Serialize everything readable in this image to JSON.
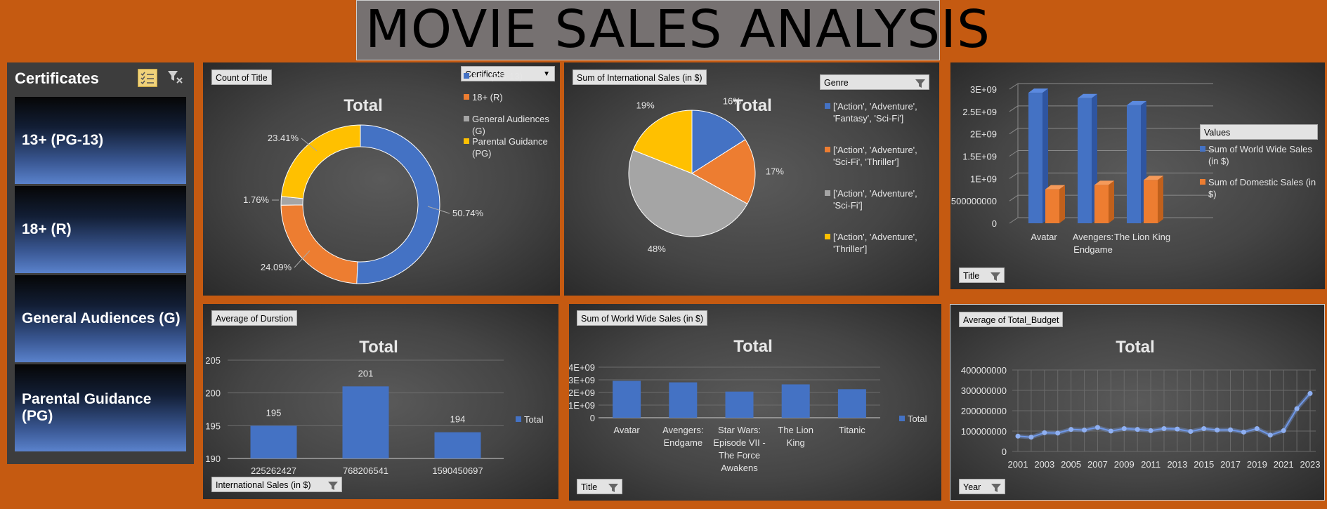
{
  "header": {
    "title": "MOVIE SALES ANALYSIS"
  },
  "slicer": {
    "title": "Certificates",
    "items": [
      "13+ (PG-13)",
      "18+ (R)",
      "General Audiences (G)",
      "Parental Guidance (PG)"
    ]
  },
  "colors": {
    "blue": "#4472c4",
    "orange": "#ed7d31",
    "gray": "#a5a5a5",
    "yellow": "#ffc000",
    "background": "#c55a11"
  },
  "panels": {
    "p1": {
      "field": "Count of Title",
      "filter": "Certificate"
    },
    "p2": {
      "field": "Sum of International  Sales (in $)",
      "filter": "Genre"
    },
    "p3": {
      "values_header": "Values",
      "filter": "Title"
    },
    "p4": {
      "field": "Average of Durstion",
      "filter": "International  Sales (in $)"
    },
    "p5": {
      "field": "Sum of World Wide Sales (in $)",
      "filter": "Title"
    },
    "p6": {
      "field": "Average of Total_Budget",
      "filter": "Year"
    }
  },
  "chart_data": [
    {
      "type": "pie",
      "variant": "doughnut",
      "title": "Total",
      "categories": [
        "13+ (PG-13)",
        "18+ (R)",
        "General Audiences (G)",
        "Parental Guidance (PG)"
      ],
      "values": [
        50.74,
        24.09,
        1.76,
        23.41
      ],
      "labels": [
        "50.74%",
        "24.09%",
        "1.76%",
        "23.41%"
      ],
      "legend": "top-right"
    },
    {
      "type": "pie",
      "title": "Total",
      "categories": [
        "['Action', 'Adventure', 'Fantasy', 'Sci-Fi']",
        "['Action', 'Adventure', 'Sci-Fi', 'Thriller']",
        "['Action', 'Adventure', 'Sci-Fi']",
        "['Action', 'Adventure', 'Thriller']"
      ],
      "values": [
        16,
        17,
        48,
        19
      ],
      "labels": [
        "16%",
        "17%",
        "48%",
        "19%"
      ],
      "legend": "right"
    },
    {
      "type": "bar",
      "variant": "3d-clustered-column",
      "categories": [
        "Avatar",
        "Avengers: Endgame",
        "The Lion King"
      ],
      "series": [
        {
          "name": "Sum of World Wide Sales (in $)",
          "values": [
            2920000000,
            2800000000,
            2640000000
          ]
        },
        {
          "name": "Sum of Domestic Sales (in $)",
          "values": [
            760000000,
            858000000,
            968000000
          ]
        }
      ],
      "yticks": [
        "0",
        "500000000",
        "1E+09",
        "1.5E+09",
        "2E+09",
        "2.5E+09",
        "3E+09"
      ],
      "ylim": [
        0,
        3000000000
      ],
      "legend": "right",
      "grid": true
    },
    {
      "type": "bar",
      "title": "Total",
      "categories": [
        "225262427",
        "768206541",
        "1590450697"
      ],
      "values": [
        195,
        201,
        194
      ],
      "labels": [
        "195",
        "201",
        "194"
      ],
      "series_name": "Total",
      "yticks": [
        "190",
        "195",
        "200",
        "205"
      ],
      "ylim": [
        190,
        205
      ],
      "legend": "right",
      "grid": true
    },
    {
      "type": "bar",
      "title": "Total",
      "categories": [
        "Avatar",
        "Avengers: Endgame",
        "Star Wars: Episode VII - The Force Awakens",
        "The Lion King",
        "Titanic"
      ],
      "values": [
        2920000000,
        2800000000,
        2070000000,
        2640000000,
        2260000000
      ],
      "series_name": "Total",
      "yticks": [
        "0",
        "1E+09",
        "2E+09",
        "3E+09",
        "4E+09"
      ],
      "ylim": [
        0,
        4000000000
      ],
      "legend": "right",
      "grid": true
    },
    {
      "type": "line",
      "title": "Total",
      "x": [
        2001,
        2002,
        2003,
        2004,
        2005,
        2006,
        2007,
        2008,
        2009,
        2010,
        2011,
        2012,
        2013,
        2014,
        2015,
        2016,
        2017,
        2018,
        2019,
        2020,
        2021,
        2022,
        2023
      ],
      "values": [
        75000000,
        70000000,
        92000000,
        90000000,
        108000000,
        105000000,
        118000000,
        100000000,
        112000000,
        108000000,
        102000000,
        112000000,
        110000000,
        98000000,
        112000000,
        105000000,
        106000000,
        95000000,
        112000000,
        80000000,
        102000000,
        210000000,
        285000000
      ],
      "xticks": [
        "2001",
        "2003",
        "2005",
        "2007",
        "2009",
        "2011",
        "2013",
        "2015",
        "2017",
        "2019",
        "2021",
        "2023"
      ],
      "yticks": [
        "0",
        "100000000",
        "200000000",
        "300000000",
        "400000000"
      ],
      "ylim": [
        0,
        400000000
      ],
      "grid": true
    }
  ]
}
